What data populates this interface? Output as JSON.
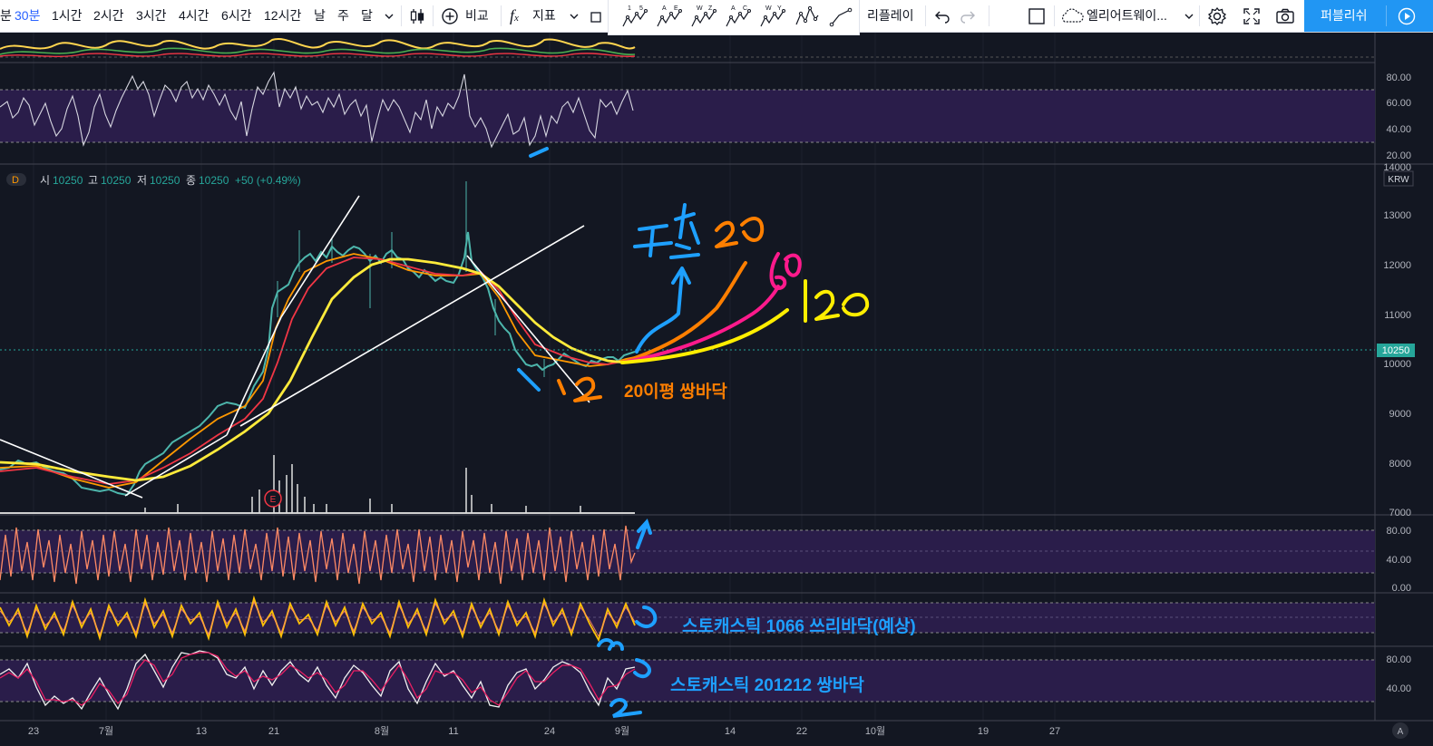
{
  "toolbar": {
    "intervals": [
      "분",
      "30분",
      "1시간",
      "2시간",
      "3시간",
      "4시간",
      "6시간",
      "12시간",
      "날",
      "주",
      "달"
    ],
    "active_interval": "30분",
    "compare_label": "비교",
    "indicators_label": "지표",
    "replay_label": "리플레이",
    "layout_name": "엘리어트웨이...",
    "publish_label": "퍼블리쉬"
  },
  "drawing_tools": [
    {
      "name": "elliott-impulse",
      "labels": [
        "1",
        "5"
      ]
    },
    {
      "name": "elliott-correction",
      "labels": [
        "A",
        "E"
      ]
    },
    {
      "name": "elliott-triangle",
      "labels": [
        "W",
        "Z"
      ]
    },
    {
      "name": "elliott-double-combo",
      "labels": [
        "A",
        "C"
      ]
    },
    {
      "name": "elliott-triple-combo",
      "labels": [
        "W",
        "Y"
      ]
    }
  ],
  "legend": {
    "interval_badge": "D",
    "open_label": "시",
    "open": "10250",
    "high_label": "고",
    "high": "10250",
    "low_label": "저",
    "low": "10250",
    "close_label": "종",
    "close": "10250",
    "change": "+50 (+0.49%)"
  },
  "currency": "KRW",
  "last_price_label": "10250",
  "price_axis": [
    "14000",
    "13000",
    "12000",
    "11000",
    "10000",
    "9000",
    "8000",
    "7000"
  ],
  "osc_top_axis": [
    "80.00",
    "60.00",
    "40.00",
    "20.00"
  ],
  "osc3_axis": [
    "80.00",
    "40.00",
    "0.00"
  ],
  "osc5_axis": [
    "80.00",
    "40.00"
  ],
  "time_axis": [
    "23",
    "7월",
    "13",
    "21",
    "8월",
    "11",
    "24",
    "9월",
    "14",
    "22",
    "10월",
    "19",
    "27"
  ],
  "earnings_marker": "E",
  "annotations": {
    "double_bottom_20": "20이평 쌍바닥",
    "stoch_1066": "스토캐스틱 1066 쓰리바닥(예상)",
    "stoch_201212": "스토캐스틱 201212 쌍바닥"
  },
  "colors": {
    "background": "#131722",
    "ma_fast": "#ff9800",
    "ma_mid": "#f23645",
    "ma_slow": "#ffeb3b",
    "osc_band": "#2a1d4a",
    "accent": "#2962ff",
    "publish": "#2196f3",
    "annot_orange": "#ff7f00",
    "annot_blue": "#1ea0ff",
    "annot_pink": "#ff1a8c",
    "annot_yellow": "#ffee00",
    "price_tag": "#26a69a"
  }
}
